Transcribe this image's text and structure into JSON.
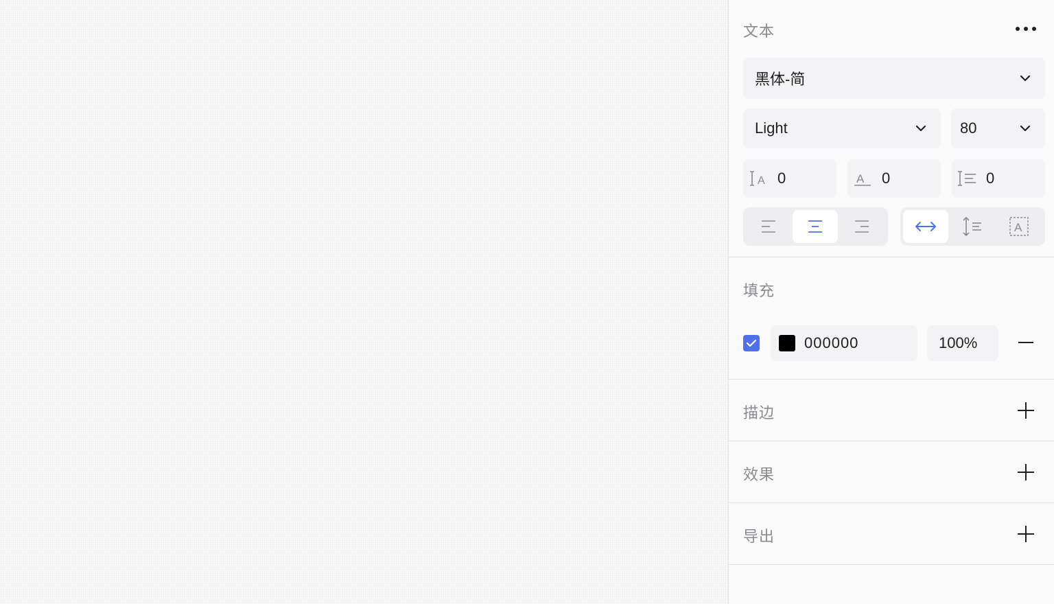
{
  "text_section": {
    "title": "文本",
    "font_family": "黑体-简",
    "font_weight": "Light",
    "font_size": "80",
    "letter_spacing": "0",
    "baseline_offset": "0",
    "line_height": "0",
    "align_options": [
      "align-left-icon",
      "align-center-icon",
      "align-right-icon"
    ],
    "selected_align": "center",
    "resize_options": [
      "auto-width-icon",
      "auto-height-icon",
      "fixed-size-icon"
    ],
    "selected_resize": "auto-width"
  },
  "fill_section": {
    "title": "填充",
    "enabled": true,
    "color_hex": "000000",
    "opacity": "100%"
  },
  "stroke_section": {
    "title": "描边"
  },
  "effects_section": {
    "title": "效果"
  },
  "export_section": {
    "title": "导出"
  },
  "colors": {
    "accent": "#4f70e8",
    "panel_bg": "#fafafb",
    "label_gray": "#8a8a90"
  }
}
